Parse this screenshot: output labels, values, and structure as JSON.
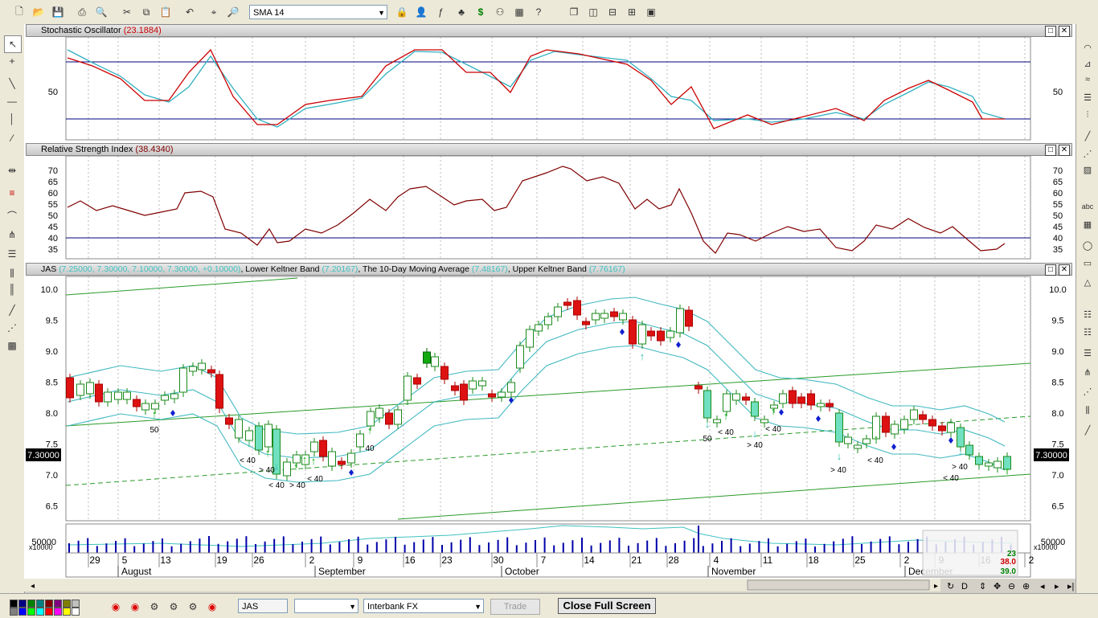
{
  "toolbar": {
    "indicator_select": "SMA 14",
    "left_icons": [
      "new-icon",
      "open-icon",
      "save-icon",
      "print-icon",
      "print-preview-icon",
      "cut-icon",
      "copy-icon",
      "paste-icon",
      "undo-icon",
      "crosshair-icon",
      "zoom-icon"
    ],
    "right_icons": [
      "lock-icon",
      "person-icon",
      "function-icon",
      "tree-icon",
      "dollar-icon",
      "binoculars-icon",
      "grid-icon",
      "help-icon",
      "window-cascade-icon",
      "window-tile-vertical-icon",
      "window-tile-horizontal-icon",
      "window-grid-icon",
      "window-detail-icon"
    ]
  },
  "panes": {
    "stochastic": {
      "title": "Stochastic Oscillator",
      "value": "(23.1884)",
      "ytick": "50",
      "value_color": "#cc0000"
    },
    "rsi": {
      "title": "Relative Strength Index",
      "value": "(38.4340)",
      "yticks": [
        "70",
        "65",
        "60",
        "55",
        "50",
        "45",
        "40",
        "35"
      ],
      "value_color": "#800000"
    },
    "price": {
      "symbol": "JAS",
      "ohlc": "(7.25000, 7.30000, 7.10000, 7.30000, +0.10000)",
      "lower_band": "Lower Keltner Band",
      "lower_value": "(7.20167)",
      "ma": "The 10-Day Moving Average",
      "ma_value": "(7.48167)",
      "upper_band": "Upper Keltner Band",
      "upper_value": "(7.76167)",
      "yticks": [
        "10.0",
        "9.5",
        "9.0",
        "8.5",
        "8.0",
        "7.5",
        "7.0",
        "6.5"
      ],
      "last_price": "7.30000",
      "annotations": [
        "50",
        "< 40",
        "> 40",
        "< 40",
        "> 40",
        "< 40",
        "40",
        "50",
        "< 40",
        "> 40",
        "< 40",
        "> 40",
        "< 40",
        "> 40",
        "< 40"
      ]
    },
    "volume": {
      "tick": "50000",
      "multiplier": "x10000"
    }
  },
  "dates": {
    "days": [
      "29",
      "5",
      "13",
      "19",
      "26",
      "2",
      "9",
      "16",
      "23",
      "30",
      "7",
      "14",
      "21",
      "28",
      "4",
      "11",
      "18",
      "25",
      "2",
      "9",
      "16",
      "2"
    ],
    "months": [
      "August",
      "September",
      "October",
      "November",
      "December"
    ]
  },
  "mini": {
    "v1": "23",
    "v2": "38.0",
    "v3": "39.0"
  },
  "bottom": {
    "symbol": "JAS",
    "empty_select": "",
    "market": "Interbank FX",
    "trade": "Trade",
    "close_full": "Close Full Screen",
    "swatch_colors": [
      "#000000",
      "#000080",
      "#008000",
      "#008080",
      "#800000",
      "#800080",
      "#808000",
      "#c0c0c0",
      "#808080",
      "#0000ff",
      "#00ff00",
      "#00ffff",
      "#ff0000",
      "#ff00ff",
      "#ffff00",
      "#ffffff"
    ]
  },
  "colors": {
    "bull_fill": "#ffffff",
    "bear_fill": "#dd1111",
    "cyan": "#40c0c0",
    "band": "#40b8c0",
    "trend": "#2a9a2a",
    "stoch_k": "#cc0000",
    "stoch_d": "#30b0c0",
    "hline": "#000080",
    "volume": "#0000aa"
  }
}
